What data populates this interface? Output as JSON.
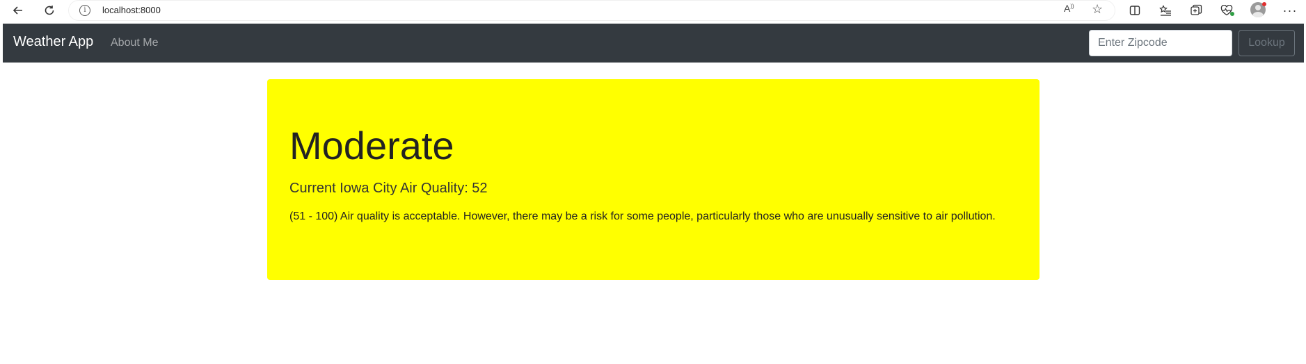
{
  "browser": {
    "url": "localhost:8000",
    "icons": {
      "back": "arrow-left-icon",
      "reload": "reload-icon",
      "info": "info-icon",
      "read_aloud": "read-aloud-icon",
      "favorite": "star-icon",
      "split_screen": "split-screen-icon",
      "favorites_list": "favorites-icon",
      "collections": "collections-icon",
      "health": "browser-essentials-icon",
      "profile": "profile-avatar-icon",
      "menu": "more-icon"
    }
  },
  "navbar": {
    "brand": "Weather App",
    "links": [
      "About Me"
    ],
    "search": {
      "placeholder": "Enter Zipcode",
      "button_label": "Lookup"
    },
    "background": "#343a40"
  },
  "air_quality": {
    "category": "Moderate",
    "summary": "Current Iowa City Air Quality: 52",
    "description": "(51 - 100) Air quality is acceptable. However, there may be a risk for some people, particularly those who are unusually sensitive to air pollution.",
    "background": "#ffff00"
  }
}
